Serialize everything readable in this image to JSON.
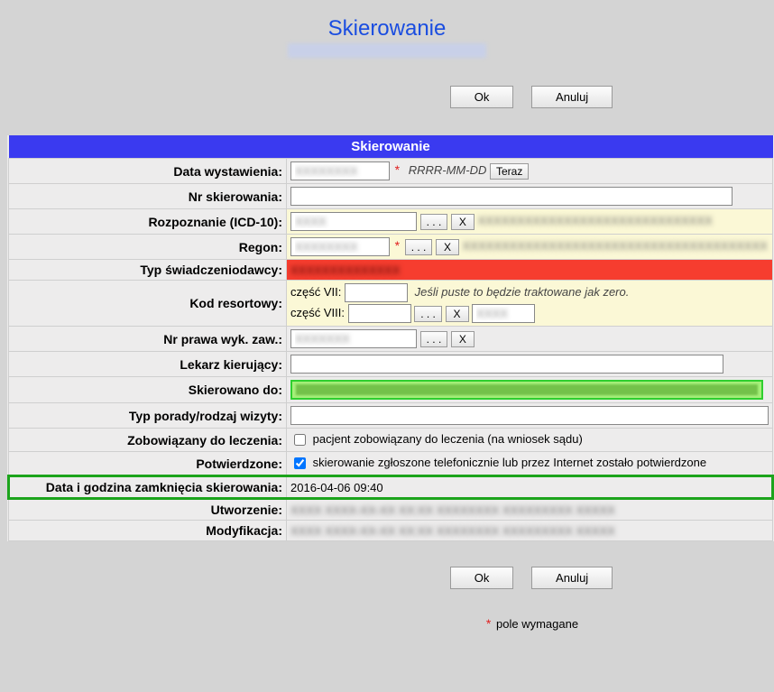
{
  "header": {
    "title": "Skierowanie"
  },
  "buttons": {
    "ok": "Ok",
    "cancel": "Anuluj",
    "now": "Teraz",
    "dots": ". . .",
    "x": "X"
  },
  "section_title": "Skierowanie",
  "labels": {
    "data_wystawienia": "Data wystawienia:",
    "nr_skierowania": "Nr skierowania:",
    "rozpoznanie": "Rozpoznanie (ICD-10):",
    "regon": "Regon:",
    "typ_swiadcz": "Typ świadczeniodawcy:",
    "kod_resortowy": "Kod resortowy:",
    "czesc7": "część VII:",
    "czesc8": "część VIII:",
    "nr_prawa": "Nr prawa wyk. zaw.:",
    "lekarz": "Lekarz kierujący:",
    "skierowano_do": "Skierowano do:",
    "typ_porady": "Typ porady/rodzaj wizyty:",
    "zobowiazany": "Zobowiązany do leczenia:",
    "potwierdzone": "Potwierdzone:",
    "data_zamkniecia": "Data i godzina zamknięcia skierowania:",
    "utworzenie": "Utworzenie:",
    "modyfikacja": "Modyfikacja:"
  },
  "values": {
    "data_wystawienia_hint": "RRRR-MM-DD",
    "kod_resortowy_hint": "Jeśli puste to będzie traktowane jak zero.",
    "zobowiazany_text": "pacjent zobowiązany do leczenia (na wniosek sądu)",
    "potwierdzone_text": "skierowanie zgłoszone telefonicznie lub przez Internet zostało potwierdzone",
    "data_zamkniecia": "2016-04-06 09:40",
    "zobowiazany_checked": false,
    "potwierdzone_checked": true
  },
  "footer": {
    "asterisk": "*",
    "note": "pole wymagane"
  }
}
